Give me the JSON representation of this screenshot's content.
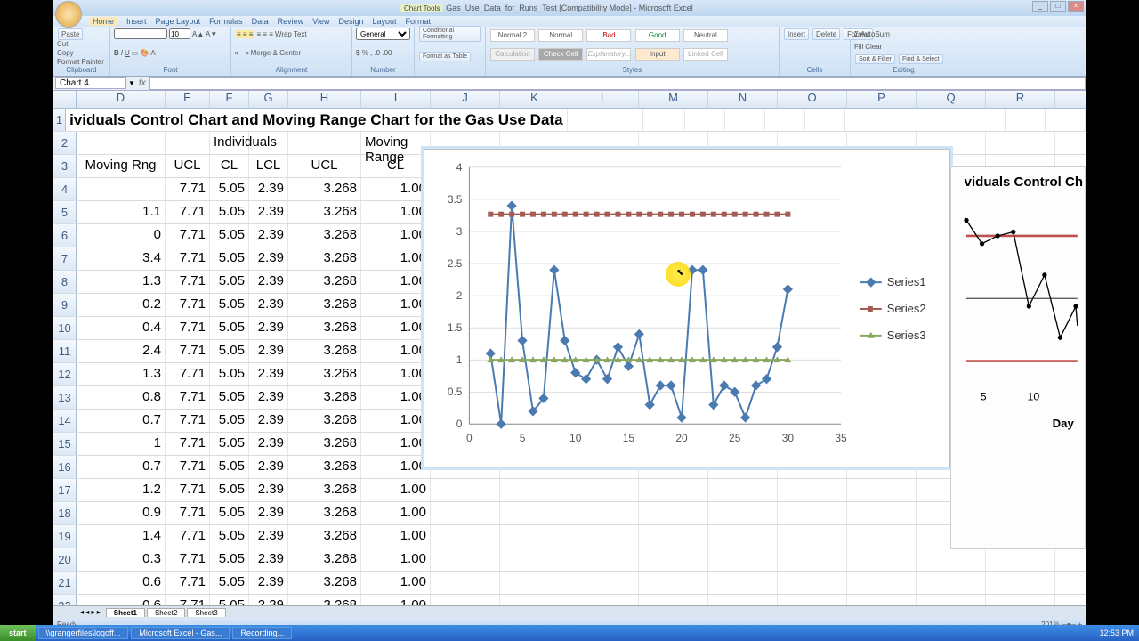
{
  "window": {
    "title": "Gas_Use_Data_for_Runs_Test [Compatibility Mode] - Microsoft Excel",
    "chart_tools": "Chart Tools"
  },
  "menu": {
    "items": [
      "Home",
      "Insert",
      "Page Layout",
      "Formulas",
      "Data",
      "Review",
      "View",
      "Design",
      "Layout",
      "Format"
    ],
    "active": "Home"
  },
  "ribbon": {
    "clipboard": {
      "paste": "Paste",
      "cut": "Cut",
      "copy": "Copy",
      "fpaint": "Format Painter",
      "label": "Clipboard"
    },
    "font": {
      "label": "Font",
      "size": "10"
    },
    "align": {
      "wrap": "Wrap Text",
      "merge": "Merge & Center",
      "label": "Alignment"
    },
    "number": {
      "general": "General",
      "label": "Number"
    },
    "styles": {
      "cf": "Conditional Formatting",
      "fat": "Format as Table",
      "n2": "Normal 2",
      "n": "Normal",
      "bad": "Bad",
      "good": "Good",
      "neutral": "Neutral",
      "calc": "Calculation",
      "chk": "Check Cell",
      "explan": "Explanatory...",
      "input": "Input",
      "linked": "Linked Cell",
      "label": "Styles"
    },
    "cells": {
      "ins": "Insert",
      "del": "Delete",
      "fmt": "Format",
      "label": "Cells"
    },
    "editing": {
      "sum": "AutoSum",
      "fill": "Fill",
      "clear": "Clear",
      "sort": "Sort & Filter",
      "find": "Find & Select",
      "label": "Editing"
    }
  },
  "namebox": "Chart 4",
  "columns": {
    "headers": [
      "D",
      "E",
      "F",
      "G",
      "H",
      "I",
      "J",
      "K",
      "L",
      "M",
      "N",
      "O",
      "P",
      "Q",
      "R"
    ],
    "widths": [
      100,
      50,
      44,
      44,
      82,
      78,
      78,
      78,
      78,
      78,
      78,
      78,
      78,
      78,
      78
    ]
  },
  "rows": [
    {
      "n": 1,
      "d": "ividuals Control Chart and Moving Range Chart for the Gas Use Data"
    },
    {
      "n": 2,
      "d": "",
      "e": "",
      "f": "Individuals",
      "g": "",
      "h": "",
      "i": "Moving Range"
    },
    {
      "n": 3,
      "d": "Moving Rng",
      "e": "UCL",
      "f": "CL",
      "g": "LCL",
      "h": "UCL",
      "i": "CL"
    },
    {
      "n": 4,
      "d": "",
      "e": "7.71",
      "f": "5.05",
      "g": "2.39",
      "h": "3.268",
      "i": "1.00"
    },
    {
      "n": 5,
      "d": "1.1",
      "e": "7.71",
      "f": "5.05",
      "g": "2.39",
      "h": "3.268",
      "i": "1.00"
    },
    {
      "n": 6,
      "d": "0",
      "e": "7.71",
      "f": "5.05",
      "g": "2.39",
      "h": "3.268",
      "i": "1.00"
    },
    {
      "n": 7,
      "d": "3.4",
      "e": "7.71",
      "f": "5.05",
      "g": "2.39",
      "h": "3.268",
      "i": "1.00"
    },
    {
      "n": 8,
      "d": "1.3",
      "e": "7.71",
      "f": "5.05",
      "g": "2.39",
      "h": "3.268",
      "i": "1.00"
    },
    {
      "n": 9,
      "d": "0.2",
      "e": "7.71",
      "f": "5.05",
      "g": "2.39",
      "h": "3.268",
      "i": "1.00"
    },
    {
      "n": 10,
      "d": "0.4",
      "e": "7.71",
      "f": "5.05",
      "g": "2.39",
      "h": "3.268",
      "i": "1.00"
    },
    {
      "n": 11,
      "d": "2.4",
      "e": "7.71",
      "f": "5.05",
      "g": "2.39",
      "h": "3.268",
      "i": "1.00"
    },
    {
      "n": 12,
      "d": "1.3",
      "e": "7.71",
      "f": "5.05",
      "g": "2.39",
      "h": "3.268",
      "i": "1.00"
    },
    {
      "n": 13,
      "d": "0.8",
      "e": "7.71",
      "f": "5.05",
      "g": "2.39",
      "h": "3.268",
      "i": "1.00"
    },
    {
      "n": 14,
      "d": "0.7",
      "e": "7.71",
      "f": "5.05",
      "g": "2.39",
      "h": "3.268",
      "i": "1.00"
    },
    {
      "n": 15,
      "d": "1",
      "e": "7.71",
      "f": "5.05",
      "g": "2.39",
      "h": "3.268",
      "i": "1.00"
    },
    {
      "n": 16,
      "d": "0.7",
      "e": "7.71",
      "f": "5.05",
      "g": "2.39",
      "h": "3.268",
      "i": "1.00"
    },
    {
      "n": 17,
      "d": "1.2",
      "e": "7.71",
      "f": "5.05",
      "g": "2.39",
      "h": "3.268",
      "i": "1.00"
    },
    {
      "n": 18,
      "d": "0.9",
      "e": "7.71",
      "f": "5.05",
      "g": "2.39",
      "h": "3.268",
      "i": "1.00"
    },
    {
      "n": 19,
      "d": "1.4",
      "e": "7.71",
      "f": "5.05",
      "g": "2.39",
      "h": "3.268",
      "i": "1.00"
    },
    {
      "n": 20,
      "d": "0.3",
      "e": "7.71",
      "f": "5.05",
      "g": "2.39",
      "h": "3.268",
      "i": "1.00"
    },
    {
      "n": 21,
      "d": "0.6",
      "e": "7.71",
      "f": "5.05",
      "g": "2.39",
      "h": "3.268",
      "i": "1.00"
    },
    {
      "n": 22,
      "d": "0.6",
      "e": "7.71",
      "f": "5.05",
      "g": "2.39",
      "h": "3.268",
      "i": "1.00"
    }
  ],
  "chart_data": {
    "type": "line",
    "x": [
      2,
      3,
      4,
      5,
      6,
      7,
      8,
      9,
      10,
      11,
      12,
      13,
      14,
      15,
      16,
      17,
      18,
      19,
      20,
      21,
      22,
      23,
      24,
      25,
      26,
      27,
      28,
      29,
      30
    ],
    "series": [
      {
        "name": "Series1",
        "values": [
          1.1,
          0,
          3.4,
          1.3,
          0.2,
          0.4,
          2.4,
          1.3,
          0.8,
          0.7,
          1,
          0.7,
          1.2,
          0.9,
          1.4,
          0.3,
          0.6,
          0.6,
          0.1,
          2.4,
          2.4,
          0.3,
          0.6,
          0.5,
          0.1,
          0.6,
          0.7,
          1.2,
          2.1
        ],
        "color": "#4a7ab0",
        "marker": "diamond"
      },
      {
        "name": "Series2",
        "values": [
          3.268,
          3.268,
          3.268,
          3.268,
          3.268,
          3.268,
          3.268,
          3.268,
          3.268,
          3.268,
          3.268,
          3.268,
          3.268,
          3.268,
          3.268,
          3.268,
          3.268,
          3.268,
          3.268,
          3.268,
          3.268,
          3.268,
          3.268,
          3.268,
          3.268,
          3.268,
          3.268,
          3.268,
          3.268
        ],
        "color": "#a45b52",
        "marker": "square"
      },
      {
        "name": "Series3",
        "values": [
          1,
          1,
          1,
          1,
          1,
          1,
          1,
          1,
          1,
          1,
          1,
          1,
          1,
          1,
          1,
          1,
          1,
          1,
          1,
          1,
          1,
          1,
          1,
          1,
          1,
          1,
          1,
          1,
          1
        ],
        "color": "#8aa760",
        "marker": "triangle"
      }
    ],
    "xlim": [
      0,
      35
    ],
    "ylim": [
      0,
      4
    ],
    "xticks": [
      0,
      5,
      10,
      15,
      20,
      25,
      30,
      35
    ],
    "yticks": [
      0,
      0.5,
      1,
      1.5,
      2,
      2.5,
      3,
      3.5,
      4
    ],
    "legend": [
      "Series1",
      "Series2",
      "Series3"
    ]
  },
  "sidechart": {
    "title": "viduals Control Ch",
    "xticks": [
      "5",
      "10"
    ],
    "xlabel": "Day"
  },
  "sheets": [
    "Sheet1",
    "Sheet2",
    "Sheet3"
  ],
  "status": {
    "ready": "Ready",
    "zoom": "201%"
  },
  "taskbar": {
    "start": "start",
    "items": [
      "\\\\grangerfiles\\logoff...",
      "Microsoft Excel - Gas...",
      "Recording..."
    ],
    "time": "12:53 PM"
  }
}
